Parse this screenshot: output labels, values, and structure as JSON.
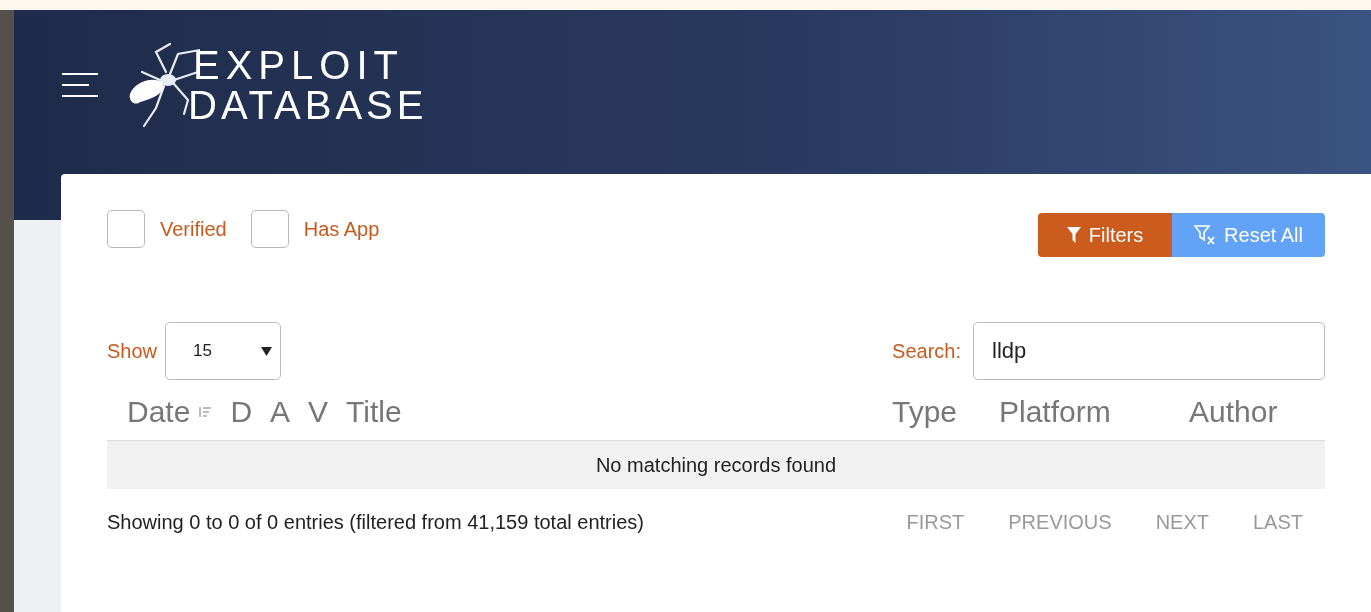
{
  "header": {
    "logo_lines": [
      "EXPLOIT",
      "DATABASE"
    ]
  },
  "filters": {
    "checkboxes": [
      {
        "label": "Verified",
        "checked": false
      },
      {
        "label": "Has App",
        "checked": false
      }
    ],
    "buttons": [
      {
        "label": "Filters",
        "kind": "filter"
      },
      {
        "label": "Reset All",
        "kind": "reset"
      }
    ]
  },
  "length": {
    "label": "Show",
    "value": "15"
  },
  "search": {
    "label": "Search:",
    "value": "lldp"
  },
  "table": {
    "columns": [
      {
        "label": "Date",
        "sorted": true
      },
      {
        "label": "D",
        "sorted": false
      },
      {
        "label": "A",
        "sorted": false
      },
      {
        "label": "V",
        "sorted": false
      },
      {
        "label": "Title",
        "sorted": false
      },
      {
        "label": "Type",
        "sorted": false
      },
      {
        "label": "Platform",
        "sorted": false
      },
      {
        "label": "Author",
        "sorted": false
      }
    ],
    "empty_message": "No matching records found"
  },
  "info": "Showing 0 to 0 of 0 entries (filtered from 41,159 total entries)",
  "pagination": [
    {
      "label": "FIRST",
      "disabled": true
    },
    {
      "label": "PREVIOUS",
      "disabled": true
    },
    {
      "label": "NEXT",
      "disabled": true
    },
    {
      "label": "LAST",
      "disabled": true
    }
  ]
}
